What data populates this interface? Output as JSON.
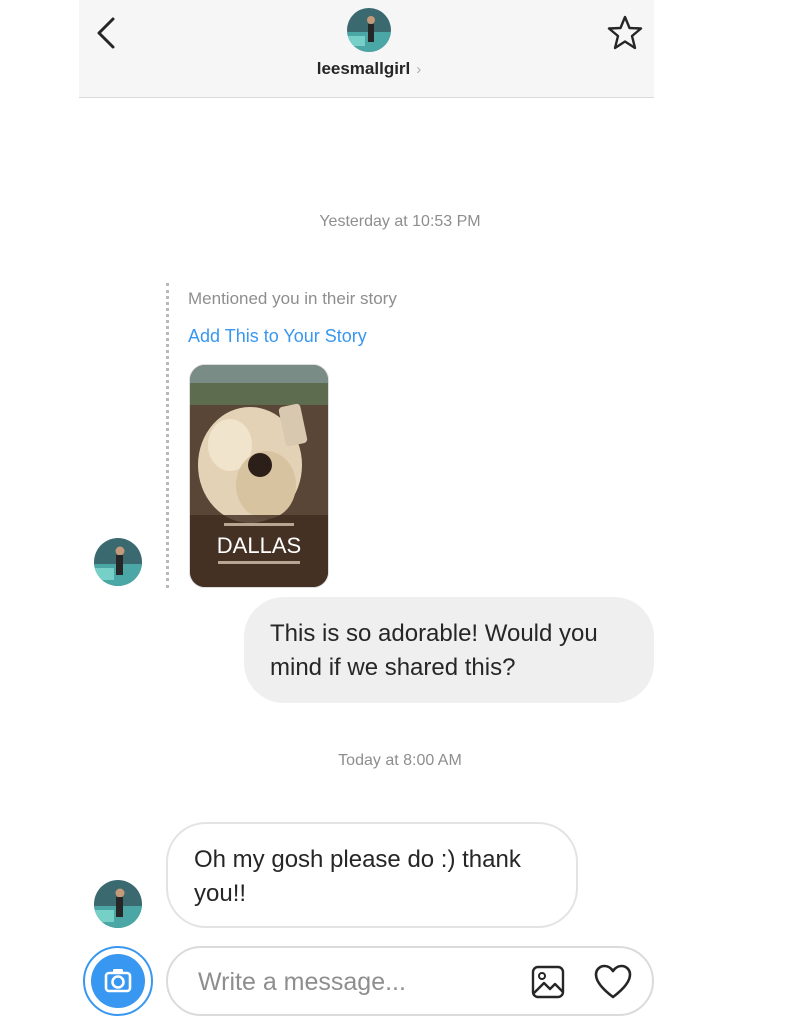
{
  "header": {
    "username": "leesmallgirl",
    "chevron": "›",
    "icons": {
      "back": "chevron-left-icon",
      "favorite": "star-icon"
    }
  },
  "conversation": {
    "timestamp_1": "Yesterday at 10:53 PM",
    "story_mention": {
      "label": "Mentioned you in their story",
      "action": "Add This to Your Story",
      "thumbnail_caption": "DALLAS"
    },
    "outgoing_message": "This is so adorable! Would you mind if we shared this?",
    "timestamp_2": "Today at 8:00 AM",
    "incoming_message": "Oh my gosh please do :) thank you!!"
  },
  "composer": {
    "placeholder": "Write a message...",
    "icons": {
      "camera": "camera-icon",
      "gallery": "image-icon",
      "like": "heart-icon"
    }
  },
  "colors": {
    "accent": "#3897f0",
    "bubble_out": "#efefef",
    "header_bg": "#f6f6f6"
  }
}
